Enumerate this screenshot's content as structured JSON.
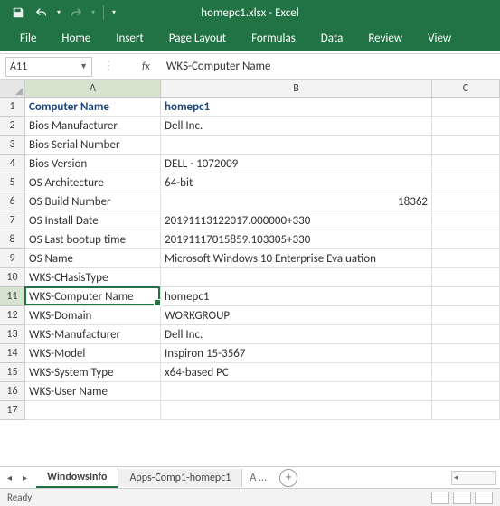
{
  "title": "homepc1.xlsx - Excel",
  "ribbon": {
    "tabs": [
      "File",
      "Home",
      "Insert",
      "Page Layout",
      "Formulas",
      "Data",
      "Review",
      "View"
    ]
  },
  "namebox": "A11",
  "formula_value": "WKS-Computer Name",
  "columns": [
    "A",
    "B",
    "C"
  ],
  "active_row": 11,
  "active_col": "A",
  "rows": [
    {
      "n": 1,
      "a": "Computer Name",
      "b": "homepc1",
      "header": true
    },
    {
      "n": 2,
      "a": "Bios Manufacturer",
      "b": "Dell Inc."
    },
    {
      "n": 3,
      "a": "Bios Serial Number",
      "b": ""
    },
    {
      "n": 4,
      "a": "Bios Version",
      "b": "DELL   - 1072009"
    },
    {
      "n": 5,
      "a": "OS Architecture",
      "b": "64-bit"
    },
    {
      "n": 6,
      "a": "OS Build Number",
      "b": "18362",
      "b_right": true
    },
    {
      "n": 7,
      "a": "OS Install Date",
      "b": "20191113122017.000000+330"
    },
    {
      "n": 8,
      "a": "OS Last bootup time",
      "b": "20191117015859.103305+330"
    },
    {
      "n": 9,
      "a": "OS Name",
      "b": "Microsoft Windows 10 Enterprise Evaluation"
    },
    {
      "n": 10,
      "a": "WKS-CHasisType",
      "b": ""
    },
    {
      "n": 11,
      "a": "WKS-Computer Name",
      "b": "homepc1"
    },
    {
      "n": 12,
      "a": "WKS-Domain",
      "b": "WORKGROUP"
    },
    {
      "n": 13,
      "a": "WKS-Manufacturer",
      "b": "Dell Inc."
    },
    {
      "n": 14,
      "a": "WKS-Model",
      "b": "Inspiron 15-3567"
    },
    {
      "n": 15,
      "a": "WKS-System Type",
      "b": "x64-based PC"
    },
    {
      "n": 16,
      "a": "WKS-User Name",
      "b": ""
    },
    {
      "n": 17,
      "a": "",
      "b": ""
    }
  ],
  "sheets": {
    "active": "WindowsInfo",
    "tabs": [
      "WindowsInfo",
      "Apps-Comp1-homepc1"
    ],
    "more": "A ..."
  },
  "status": "Ready"
}
